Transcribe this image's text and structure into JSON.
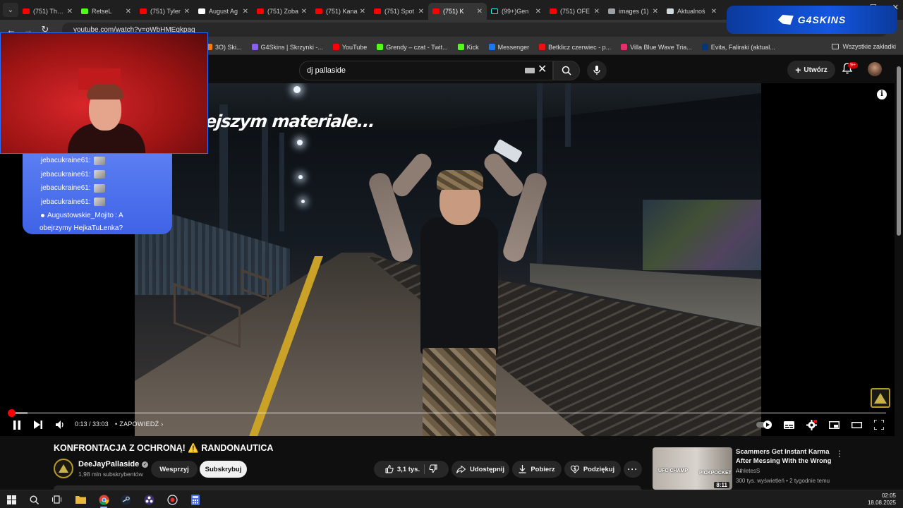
{
  "browser": {
    "tabs": [
      {
        "label": "(751) The V",
        "favicon": "youtube",
        "active": false
      },
      {
        "label": "RetseL",
        "favicon": "kick",
        "active": false
      },
      {
        "label": "(751) Tyler",
        "favicon": "youtube",
        "active": false
      },
      {
        "label": "August Ag",
        "favicon": "wikipedia",
        "active": false
      },
      {
        "label": "(751) Zoba",
        "favicon": "youtube",
        "active": false
      },
      {
        "label": "(751) Kana",
        "favicon": "youtube",
        "active": false
      },
      {
        "label": "(751) Spot",
        "favicon": "youtube",
        "active": false
      },
      {
        "label": "(751) K",
        "favicon": "youtube",
        "active": true
      },
      {
        "label": "(99+)Gen",
        "favicon": "tiktok",
        "active": false
      },
      {
        "label": "(751) OFE",
        "favicon": "youtube",
        "active": false
      },
      {
        "label": "images (1)",
        "favicon": "globe",
        "active": false
      },
      {
        "label": "Aktualnoś",
        "favicon": "site",
        "active": false
      }
    ],
    "url": "youtube.com/watch?v=oWbHMEqkpaq",
    "bookmarks": [
      {
        "label": "3O) Ski...",
        "color": "#ff7a00"
      },
      {
        "label": "G4Skins | Skrzynki -...",
        "color": "#8b5cf6"
      },
      {
        "label": "YouTube",
        "color": "#ff0000"
      },
      {
        "label": "Grendy – czat - Twit...",
        "color": "#53fc18"
      },
      {
        "label": "Kick",
        "color": "#53fc18"
      },
      {
        "label": "Messenger",
        "color": "#1877f2"
      },
      {
        "label": "Betklicz czerwiec - p...",
        "color": "#e11"
      },
      {
        "label": "Villa Blue Wave Tria...",
        "color": "#e1306c"
      },
      {
        "label": "Evita, Faliraki (aktual...",
        "color": "#003580"
      }
    ],
    "all_bookmarks": "Wszystkie zakładki"
  },
  "overlay": {
    "brand": "G4SKINS",
    "chat": [
      {
        "user": "jebacukraine61",
        "text": ":"
      },
      {
        "user": "jebacukraine61",
        "text": ":"
      },
      {
        "user": "jebacukraine61",
        "text": ":"
      },
      {
        "user": "jebacukraine61",
        "text": ":"
      }
    ],
    "chat_last_user": "Augustowskie_Mojito",
    "chat_last_text": ": A",
    "chat_last_text2": "obejrzymy HejkaTuLenka?"
  },
  "youtube": {
    "search_value": "dj pallaside",
    "create_label": "Utwórz",
    "notifications_badge": "9+",
    "video_overlay_text": "ejszym materiale...",
    "time_current": "0:13",
    "time_total": "33:03",
    "chapter": "ZAPOWIEDŹ",
    "progress": {
      "played_fraction": 0.003,
      "buffered_fraction": 0.022
    },
    "title": "KONFRONTACJA Z OCHRONĄ! ⚠️ RANDONAUTICA",
    "channel": "DeeJayPallaside",
    "subscribers": "1,98 mln subskrybentów",
    "support_label": "Wesprzyj",
    "subscribe_label": "Subskrybuj",
    "likes": "3,1 tys.",
    "share_label": "Udostępnij",
    "download_label": "Pobierz",
    "thanks_label": "Podziękuj",
    "recommended": {
      "title": "Scammers Get Instant Karma After Messing With the Wrong ...",
      "channel": "AthletesS",
      "meta": "300 tys. wyświetleń • 2 tygodnie temu",
      "duration": "8:11",
      "thumb_left": "UFC CHAMP",
      "thumb_right": "PICKPOCKET"
    }
  },
  "taskbar": {
    "time": "02:05",
    "date": "18.08.2025"
  },
  "colors": {
    "yt_red": "#ff0000",
    "chat_blue": "#4a6ef0",
    "bg": "#0f0f0f"
  }
}
